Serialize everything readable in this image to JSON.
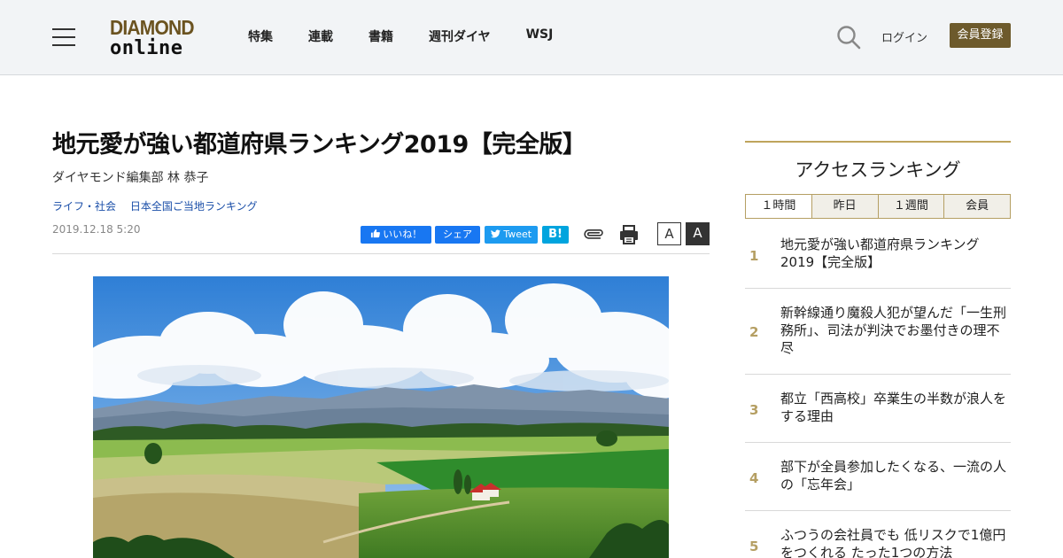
{
  "header": {
    "logo_top": "DIAMOND",
    "logo_bottom": "online",
    "nav": [
      "特集",
      "連載",
      "書籍",
      "週刊ダイヤ",
      "WSJ"
    ],
    "login_label": "ログイン",
    "register_label": "会員登録"
  },
  "article": {
    "title": "地元愛が強い都道府県ランキング2019【完全版】",
    "author": "ダイヤモンド編集部 林 恭子",
    "categories": [
      "ライフ・社会",
      "日本全国ご当地ランキング"
    ],
    "date": "2019.12.18 5:20",
    "share": {
      "facebook_like": "いいね！",
      "facebook_share": "シェア",
      "twitter": "Tweet",
      "hatena": "B!"
    },
    "font_small_label": "A",
    "font_large_label": "A"
  },
  "ranking": {
    "title": "アクセスランキング",
    "tabs": [
      "１時間",
      "昨日",
      "１週間",
      "会員"
    ],
    "items": [
      {
        "rank": "1",
        "text": "地元愛が強い都道府県ランキング2019【完全版】"
      },
      {
        "rank": "2",
        "text": "新幹線通り魔殺人犯が望んだ「一生刑務所」、司法が判決でお墨付きの理不尽"
      },
      {
        "rank": "3",
        "text": "都立「西高校」卒業生の半数が浪人をする理由"
      },
      {
        "rank": "4",
        "text": "部下が全員参加したくなる、一流の人の「忘年会」"
      },
      {
        "rank": "5",
        "text": "ふつうの会社員でも 低リスクで1億円をつくれる たった1つの方法"
      }
    ]
  },
  "colors": {
    "header_bg": "#f2f4f6",
    "brand_gold": "#6d5a2c",
    "ranking_accent": "#b59f63",
    "link_blue": "#1a4ea8",
    "facebook_blue": "#1877f2",
    "twitter_blue": "#1d9bf0",
    "hatena_blue": "#00a4de"
  },
  "icons": {
    "menu": "hamburger-menu-icon",
    "search": "search-icon",
    "attach": "paperclip-icon",
    "print": "printer-icon"
  }
}
